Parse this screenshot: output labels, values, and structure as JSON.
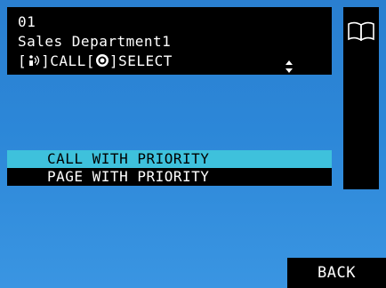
{
  "header": {
    "number": "01",
    "name": "Sales Department1",
    "instr_open": "[",
    "call_icon": "intercom-wave-icon",
    "instr_call": "]CALL[",
    "select_icon": "target-dial-icon",
    "instr_select": "]SELECT",
    "scroll_icon": "up-down-arrows-icon"
  },
  "side_panel": {
    "icon": "book-icon"
  },
  "menu": {
    "items": [
      {
        "label": "CALL WITH PRIORITY",
        "selected": true
      },
      {
        "label": "PAGE WITH PRIORITY",
        "selected": false
      }
    ]
  },
  "footer": {
    "back_label": "BACK"
  },
  "colors": {
    "background": "#2c87d8",
    "panel": "#000000",
    "highlight": "#3ec1dc",
    "text": "#ffffff"
  }
}
